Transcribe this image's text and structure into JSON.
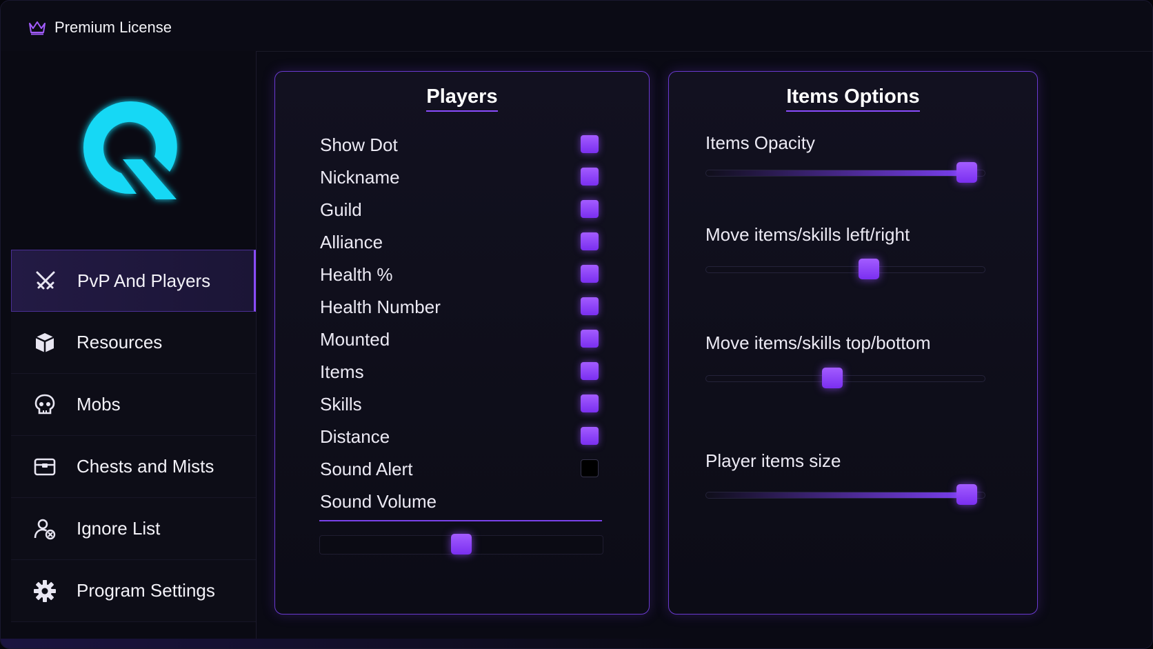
{
  "titlebar": {
    "title": "Premium License",
    "icon": "crown-icon"
  },
  "logo": {
    "icon": "q-logo",
    "color": "#12d8f5"
  },
  "sidebar": {
    "items": [
      {
        "label": "PvP And Players",
        "icon": "crossed-swords-icon",
        "active": true
      },
      {
        "label": "Resources",
        "icon": "cube-icon",
        "active": false
      },
      {
        "label": "Mobs",
        "icon": "skull-icon",
        "active": false
      },
      {
        "label": "Chests and Mists",
        "icon": "chest-icon",
        "active": false
      },
      {
        "label": "Ignore List",
        "icon": "user-block-icon",
        "active": false
      },
      {
        "label": "Program Settings",
        "icon": "gear-icon",
        "active": false
      }
    ]
  },
  "players": {
    "title": "Players",
    "options": [
      {
        "label": "Show Dot",
        "checked": true
      },
      {
        "label": "Nickname",
        "checked": true
      },
      {
        "label": "Guild",
        "checked": true
      },
      {
        "label": "Alliance",
        "checked": true
      },
      {
        "label": "Health %",
        "checked": true
      },
      {
        "label": "Health Number",
        "checked": true
      },
      {
        "label": "Mounted",
        "checked": true
      },
      {
        "label": "Items",
        "checked": true
      },
      {
        "label": "Skills",
        "checked": true
      },
      {
        "label": "Distance",
        "checked": true
      },
      {
        "label": "Sound Alert",
        "checked": false
      }
    ],
    "sound_volume": {
      "label": "Sound Volume",
      "value": 0.5
    }
  },
  "items_options": {
    "title": "Items Options",
    "sliders": [
      {
        "label": "Items Opacity",
        "value": 0.97
      },
      {
        "label": "Move items/skills left/right",
        "value": 0.59
      },
      {
        "label": "Move items/skills top/bottom",
        "value": 0.45
      },
      {
        "label": "Player items size",
        "value": 0.97
      }
    ]
  },
  "colors": {
    "accent": "#8b4dff",
    "background": "#0a0a14",
    "logo": "#12d8f5"
  }
}
